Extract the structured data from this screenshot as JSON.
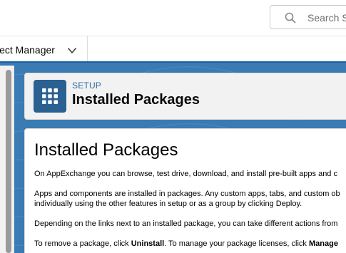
{
  "header": {
    "search_placeholder": "Search S"
  },
  "nav": {
    "app_name": "ject Manager"
  },
  "setup_header": {
    "label": "SETUP",
    "title": "Installed Packages",
    "icon": "grid-icon"
  },
  "main": {
    "heading": "Installed Packages",
    "paragraphs": [
      "On AppExchange you can browse, test drive, download, and install pre-built apps and c",
      "Apps and components are installed in packages. Any custom apps, tabs, and custom ob",
      "individually using the other features in setup or as a group by clicking Deploy.",
      "Depending on the links next to an installed package, you can take different actions from"
    ],
    "remove_prefix": "To remove a package, click ",
    "uninstall_word": "Uninstall",
    "remove_middle": ". To manage your package licenses, click ",
    "manage_word": "Manage"
  },
  "colors": {
    "accent": "#1b5f9e",
    "setup_tile": "#2a6192",
    "background": "#3a7bb3"
  }
}
